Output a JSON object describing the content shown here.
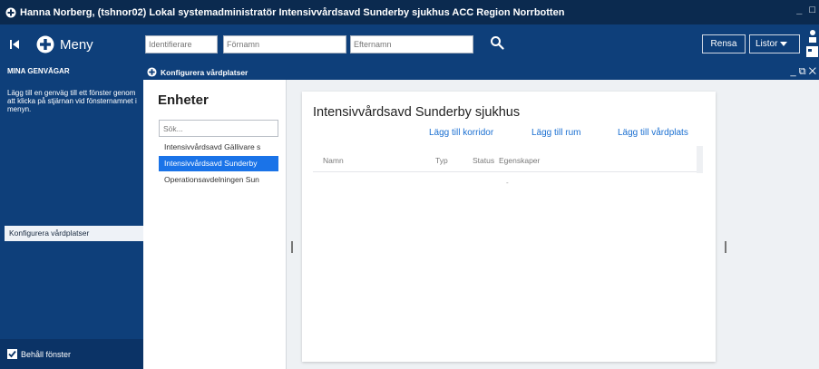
{
  "window": {
    "title": "Hanna  Norberg, (tshnor02) Lokal systemadministratör Intensivvårdsavd Sunderby sjukhus ACC Region Norrbotten",
    "minimize_glyph": "_",
    "maximize_glyph": "□"
  },
  "toolbar": {
    "menu_label": "Meny",
    "search_fields": [
      {
        "placeholder": "Identifierare"
      },
      {
        "placeholder": "Förnamn"
      },
      {
        "placeholder": "Efternamn"
      }
    ],
    "clear_label": "Rensa",
    "lists_label": "Listor"
  },
  "sidebar": {
    "heading": "MINA GENVÄGAR",
    "help_text": "Lägg till en genväg till ett fönster genom att klicka på stjärnan vid fönsternamnet i menyn.",
    "shortcut_item": "Konfigurera vårdplatser",
    "keep_windows_label": "Behåll fönster",
    "keep_windows_checked": true
  },
  "pane": {
    "title": "Konfigurera vårdplatser",
    "window_controls": "_ ⧉ ✕"
  },
  "units": {
    "title": "Enheter",
    "search_placeholder": "Sök...",
    "items": [
      {
        "label": "Intensivvårdsavd Gällivare s",
        "selected": false
      },
      {
        "label": "Intensivvårdsavd Sunderby",
        "selected": true
      },
      {
        "label": "Operationsavdelningen Sun",
        "selected": false
      }
    ]
  },
  "detail": {
    "title": "Intensivvårdsavd Sunderby sjukhus",
    "actions": [
      "Lägg till korridor",
      "Lägg till rum",
      "Lägg till vårdplats"
    ],
    "columns": [
      "Namn",
      "Typ",
      "Status",
      "Egenskaper"
    ],
    "empty_marker": "-"
  },
  "colors": {
    "titlebar": "#0b2a4f",
    "toolbar": "#0e3f7a",
    "selection": "#1a73e8",
    "link": "#1a6fd1"
  },
  "icons": {
    "toolbar_first": "skip-first-icon",
    "menu": "plus-circle-icon",
    "search": "search-icon",
    "user": "user-icon",
    "checkbox": "checkbox-checked-icon"
  }
}
